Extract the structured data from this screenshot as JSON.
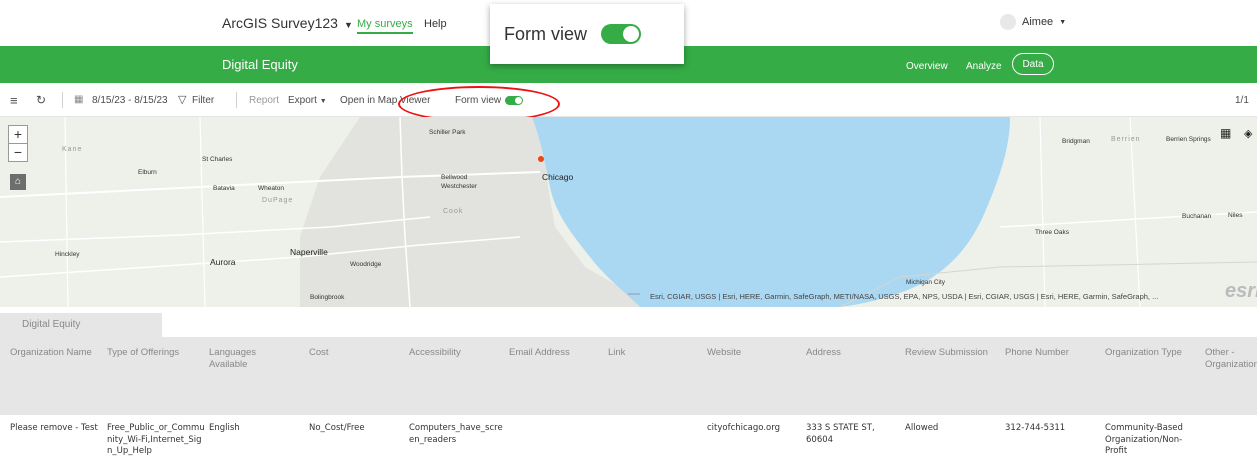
{
  "header": {
    "brand": "ArcGIS Survey123",
    "nav": [
      "My surveys",
      "Help"
    ],
    "user": "Aimee"
  },
  "survey": {
    "title": "Digital Equity",
    "tabs": [
      "Overview",
      "Analyze",
      "Data"
    ]
  },
  "callout": {
    "label": "Form view",
    "toggle_on": true
  },
  "toolbar": {
    "date_range": "8/15/23 - 8/15/23",
    "filter": "Filter",
    "report": "Report",
    "export": "Export",
    "open_map": "Open in Map Viewer",
    "form_view": "Form view",
    "page": "1/1"
  },
  "map": {
    "labels": [
      "Kane",
      "St Charles",
      "Elburn",
      "Batavia",
      "Wheaton",
      "DuPage",
      "Bellwood",
      "Westchester",
      "Cook",
      "Schiller Park",
      "Chicago",
      "Naperville",
      "Woodridge",
      "Aurora",
      "Hinckley",
      "Bolingbrook",
      "Bridgman",
      "Berrien",
      "Berrien Springs",
      "Buchanan",
      "Niles",
      "Three Oaks",
      "Michigan City"
    ],
    "attribution": "Esri, CGIAR, USGS | Esri, HERE, Garmin, SafeGraph, METI/NASA, USGS, EPA, NPS, USDA | Esri, CGIAR, USGS | Esri, HERE, Garmin, SafeGraph, ...",
    "logo": "esri",
    "colors": {
      "water": "#aad7f2",
      "land": "#eef0ea",
      "marker": "#e8471c"
    }
  },
  "table": {
    "tab": "Digital Equity",
    "columns": [
      "Organization Name",
      "Type of Offerings",
      "Languages Available",
      "Cost",
      "Accessibility",
      "Email Address",
      "Link",
      "Website",
      "Address",
      "Review Submission",
      "Phone Number",
      "Organization Type",
      "Other - Organization"
    ],
    "rows": [
      {
        "org_name": "Please remove - Test",
        "offerings": "Free_Public_or_Community_Wi-Fi,Internet_Sign_Up_Help",
        "languages": "English",
        "cost": "No_Cost/Free",
        "accessibility": "Computers_have_screen_readers",
        "email": "",
        "link": "",
        "website": "cityofchicago.org",
        "address": "333 S STATE ST, 60604",
        "review": "Allowed",
        "phone": "312-744-5311",
        "org_type": "Community-Based Organization/Non-Profit",
        "other": ""
      }
    ]
  },
  "colors": {
    "accent": "#35ac46",
    "highlight": "#ee1111"
  }
}
